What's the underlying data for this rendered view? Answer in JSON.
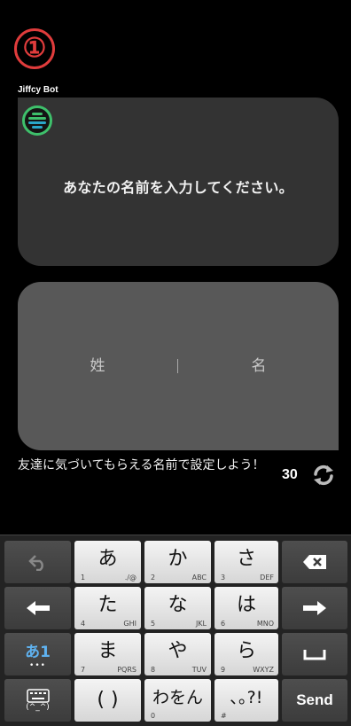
{
  "step_number": "①",
  "bot": {
    "name": "Jiffcy Bot",
    "message": "あなたの名前を入力してください。"
  },
  "name_input": {
    "last_placeholder": "姓",
    "first_placeholder": "名"
  },
  "hint": "友達に気づいてもらえる名前で設定しよう！",
  "char_count": "30",
  "colors": {
    "accent_red": "#e03c3c",
    "avatar_green": "#3ec06b"
  },
  "keyboard": {
    "mode_label": "あ1",
    "mode_dots": "•••",
    "emoticon_label": "(^_^)",
    "send_label": "Send",
    "keys": [
      {
        "main": "あ",
        "num": "1",
        "chars": "./@"
      },
      {
        "main": "か",
        "num": "2",
        "chars": "ABC"
      },
      {
        "main": "さ",
        "num": "3",
        "chars": "DEF"
      },
      {
        "main": "た",
        "num": "4",
        "chars": "GHI"
      },
      {
        "main": "な",
        "num": "5",
        "chars": "JKL"
      },
      {
        "main": "は",
        "num": "6",
        "chars": "MNO"
      },
      {
        "main": "ま",
        "num": "7",
        "chars": "PQRS"
      },
      {
        "main": "や",
        "num": "8",
        "chars": "TUV"
      },
      {
        "main": "ら",
        "num": "9",
        "chars": "WXYZ"
      },
      {
        "main": "( )",
        "num": "",
        "chars": ""
      },
      {
        "main": "わをん",
        "num": "0",
        "chars": ""
      },
      {
        "main": "､｡?!",
        "num": "#",
        "chars": ""
      }
    ]
  }
}
